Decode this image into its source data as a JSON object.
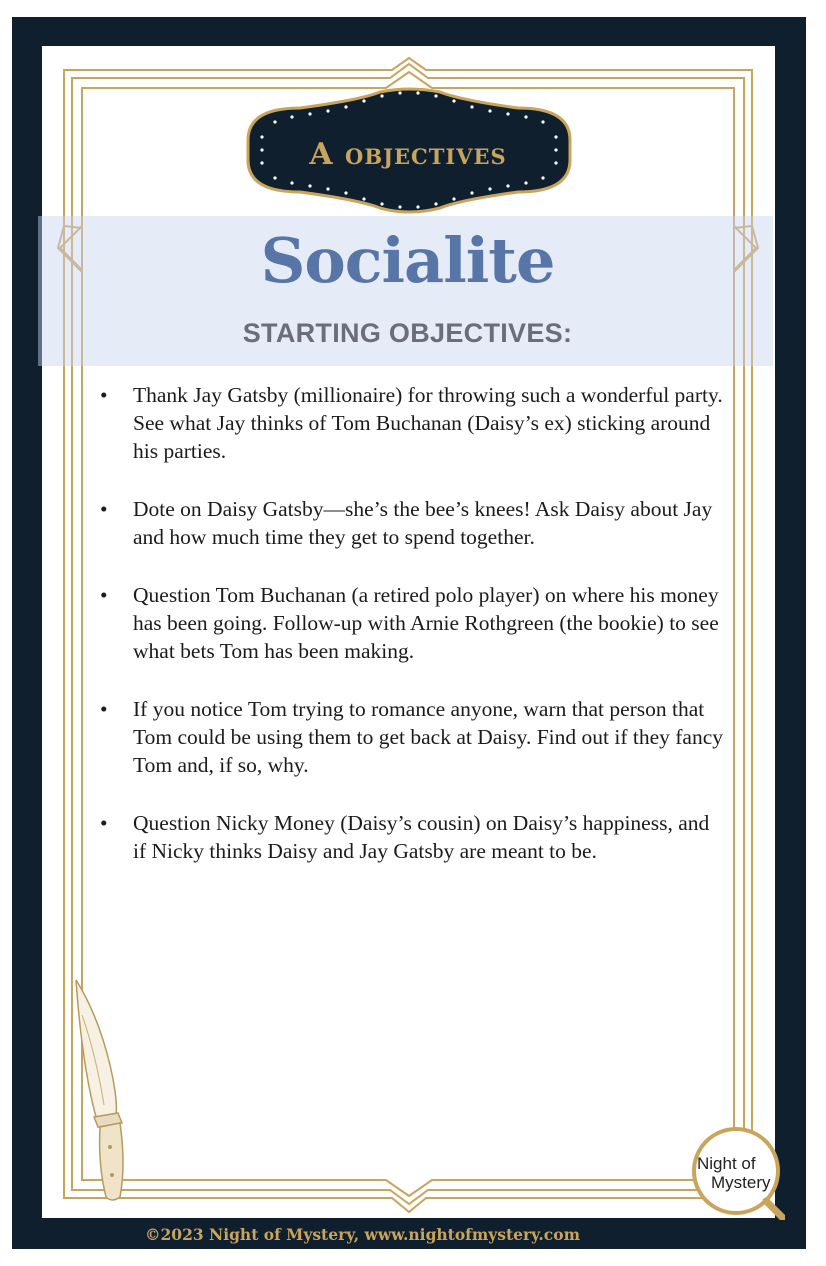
{
  "card": {
    "badge": "A objectives",
    "title": "Socialite",
    "subtitle": "STARTING OBJECTIVES:",
    "bullet_symbol": "•",
    "objectives": [
      "Thank Jay Gatsby (millionaire) for throwing such a wonderful party. See what Jay thinks of Tom Buchanan (Daisy’s ex) sticking around his parties.",
      "Dote on Daisy Gatsby—she’s the bee’s knees! Ask Daisy about Jay and how much time they get to spend together.",
      "Question Tom Buchanan (a retired polo player) on where his money has been going. Follow-up with Arnie Rothgreen (the bookie) to see what bets Tom has been making.",
      "If you notice Tom trying to romance anyone, warn that person that Tom could be using them to get back at Daisy. Find out if they fancy Tom and, if so, why.",
      "Question Nicky Money (Daisy’s cousin) on Daisy’s happiness, and if Nicky thinks Daisy and Jay Gatsby are meant to be."
    ]
  },
  "logo": {
    "line1": "Night of",
    "line2": "Mystery"
  },
  "footer": "©2023 Night of Mystery, www.nightofmystery.com",
  "colors": {
    "navy": "#0f1f2e",
    "gold": "#c9a45c",
    "title_blue": "#5875a8",
    "band": "#e6ebf8"
  },
  "icons": [
    "knife-icon",
    "magnifying-glass-icon"
  ]
}
